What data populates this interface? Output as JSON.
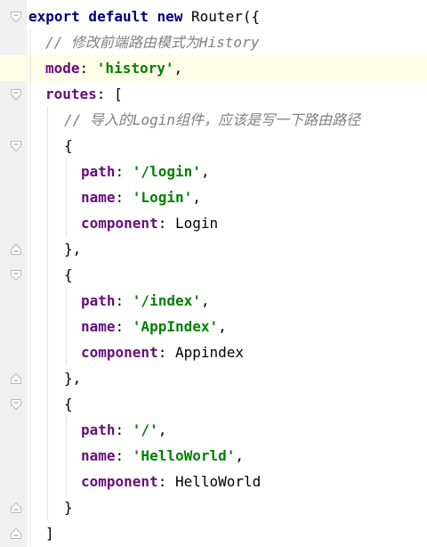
{
  "editor": {
    "current_line_index": 2,
    "lines": [
      {
        "segments": [
          {
            "t": "kw",
            "v": "export default new "
          },
          {
            "t": "pl",
            "v": "Router({"
          }
        ]
      },
      {
        "segments": [
          {
            "t": "cm",
            "v": "// 修改前端路由模式为History"
          }
        ]
      },
      {
        "segments": [
          {
            "t": "prop",
            "v": "mode"
          },
          {
            "t": "pl",
            "v": ": "
          },
          {
            "t": "str",
            "v": "'history'"
          },
          {
            "t": "pl",
            "v": ","
          }
        ]
      },
      {
        "segments": [
          {
            "t": "prop",
            "v": "routes"
          },
          {
            "t": "pl",
            "v": ": ["
          }
        ]
      },
      {
        "segments": [
          {
            "t": "cm",
            "v": "// 导入的Login组件，应该是写一下路由路径"
          }
        ]
      },
      {
        "segments": [
          {
            "t": "pl",
            "v": "{"
          }
        ]
      },
      {
        "segments": [
          {
            "t": "prop",
            "v": "path"
          },
          {
            "t": "pl",
            "v": ": "
          },
          {
            "t": "str",
            "v": "'/login'"
          },
          {
            "t": "pl",
            "v": ","
          }
        ]
      },
      {
        "segments": [
          {
            "t": "prop",
            "v": "name"
          },
          {
            "t": "pl",
            "v": ": "
          },
          {
            "t": "str",
            "v": "'Login'"
          },
          {
            "t": "pl",
            "v": ","
          }
        ]
      },
      {
        "segments": [
          {
            "t": "prop",
            "v": "component"
          },
          {
            "t": "pl",
            "v": ": Login"
          }
        ]
      },
      {
        "segments": [
          {
            "t": "pl",
            "v": "},"
          }
        ]
      },
      {
        "segments": [
          {
            "t": "pl",
            "v": "{"
          }
        ]
      },
      {
        "segments": [
          {
            "t": "prop",
            "v": "path"
          },
          {
            "t": "pl",
            "v": ": "
          },
          {
            "t": "str",
            "v": "'/index'"
          },
          {
            "t": "pl",
            "v": ","
          }
        ]
      },
      {
        "segments": [
          {
            "t": "prop",
            "v": "name"
          },
          {
            "t": "pl",
            "v": ": "
          },
          {
            "t": "str",
            "v": "'AppIndex'"
          },
          {
            "t": "pl",
            "v": ","
          }
        ]
      },
      {
        "segments": [
          {
            "t": "prop",
            "v": "component"
          },
          {
            "t": "pl",
            "v": ": Appindex"
          }
        ]
      },
      {
        "segments": [
          {
            "t": "pl",
            "v": "},"
          }
        ]
      },
      {
        "segments": [
          {
            "t": "pl",
            "v": "{"
          }
        ]
      },
      {
        "segments": [
          {
            "t": "prop",
            "v": "path"
          },
          {
            "t": "pl",
            "v": ": "
          },
          {
            "t": "str",
            "v": "'/'"
          },
          {
            "t": "pl",
            "v": ","
          }
        ]
      },
      {
        "segments": [
          {
            "t": "prop",
            "v": "name"
          },
          {
            "t": "pl",
            "v": ": "
          },
          {
            "t": "str",
            "v": "'HelloWorld'"
          },
          {
            "t": "pl",
            "v": ","
          }
        ]
      },
      {
        "segments": [
          {
            "t": "prop",
            "v": "component"
          },
          {
            "t": "pl",
            "v": ": HelloWorld"
          }
        ]
      },
      {
        "segments": [
          {
            "t": "pl",
            "v": "}"
          }
        ]
      },
      {
        "segments": [
          {
            "t": "pl",
            "v": "]"
          }
        ]
      }
    ]
  },
  "colors": {
    "keyword": "#000080",
    "property": "#660e7a",
    "string": "#008000",
    "comment": "#808080",
    "current_line": "#fefbe7",
    "gutter": "#f0f0f0"
  }
}
